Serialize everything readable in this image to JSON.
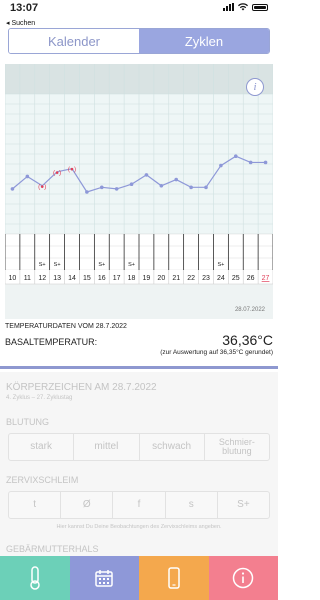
{
  "status": {
    "time": "13:07"
  },
  "nav": {
    "back_label": "◂ Suchen"
  },
  "segments": {
    "calendar": "Kalender",
    "cycles": "Zyklen"
  },
  "chart_data": {
    "type": "line",
    "x": [
      10,
      11,
      12,
      13,
      14,
      15,
      16,
      17,
      18,
      19,
      20,
      21,
      22,
      23,
      24,
      25,
      26,
      27
    ],
    "values": [
      36.19,
      36.27,
      36.21,
      36.3,
      36.32,
      36.17,
      36.2,
      36.19,
      36.22,
      36.28,
      36.21,
      36.25,
      36.2,
      36.2,
      36.34,
      36.4,
      36.36,
      36.36
    ],
    "excluded_days": [
      12,
      13,
      14
    ],
    "markers_row": [
      "",
      "",
      "S+",
      "S+",
      "",
      "",
      "S+",
      "",
      "S+",
      "",
      "",
      "",
      "",
      "",
      "S+",
      "",
      "",
      ""
    ],
    "highlight_day": 27,
    "ylim": [
      35.9,
      36.8
    ],
    "date_label": "28.07.2022"
  },
  "temperature": {
    "heading": "TEMPERATURDATEN VOM 28.7.2022",
    "label": "BASALTEMPERATUR:",
    "value": "36,36°C",
    "note": "(zur Auswertung auf 36,35°C gerundet)"
  },
  "body_signs": {
    "title": "KÖRPERZEICHEN AM 28.7.2022",
    "subtitle": "4. Zyklus – 27. Zyklustag",
    "bleeding_label": "BLUTUNG",
    "bleeding_options": [
      "stark",
      "mittel",
      "schwach",
      "Schmier-\nblutung"
    ],
    "mucus_label": "ZERVIXSCHLEIM",
    "mucus_options": [
      "t",
      "Ø",
      "f",
      "s",
      "S+"
    ],
    "mucus_hint": "Hier kannst Du Deine Beobachtungen des Zervixschleims angeben.",
    "cervix_label": "GEBÄRMUTTERHALS"
  },
  "tabbar": {
    "tabs": [
      {
        "icon": "thermometer-icon",
        "color": "#6cd0b8"
      },
      {
        "icon": "calendar-icon",
        "color": "#8e98d8"
      },
      {
        "icon": "phone-icon",
        "color": "#f4a84d"
      },
      {
        "icon": "info-icon",
        "color": "#f37f8f"
      }
    ]
  }
}
